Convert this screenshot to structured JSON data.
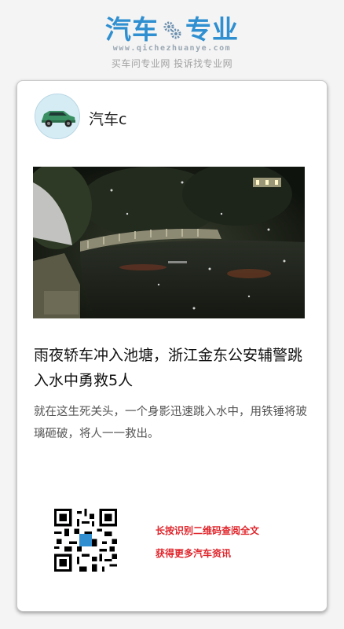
{
  "header": {
    "logo_left": "汽车",
    "logo_right": "专业",
    "logo_icon": "gears-icon",
    "url": "www.qichezhuanye.com",
    "slogan": "买车问专业网 投诉找专业网"
  },
  "post": {
    "author": "汽车c",
    "avatar_icon": "car-icon",
    "title": "雨夜轿车冲入池塘，浙江金东公安辅警跳入水中勇救5人",
    "summary": "就在这生死关头，一个身影迅速跳入水中，用铁锤将玻璃砸破，将人一一救出。"
  },
  "footer": {
    "qr_icon": "qr-code-icon",
    "cta_line1": "长按识别二维码查阅全文",
    "cta_line2": "获得更多汽车资讯"
  },
  "colors": {
    "brand": "#2f8fd0",
    "cta": "#e0242a"
  }
}
